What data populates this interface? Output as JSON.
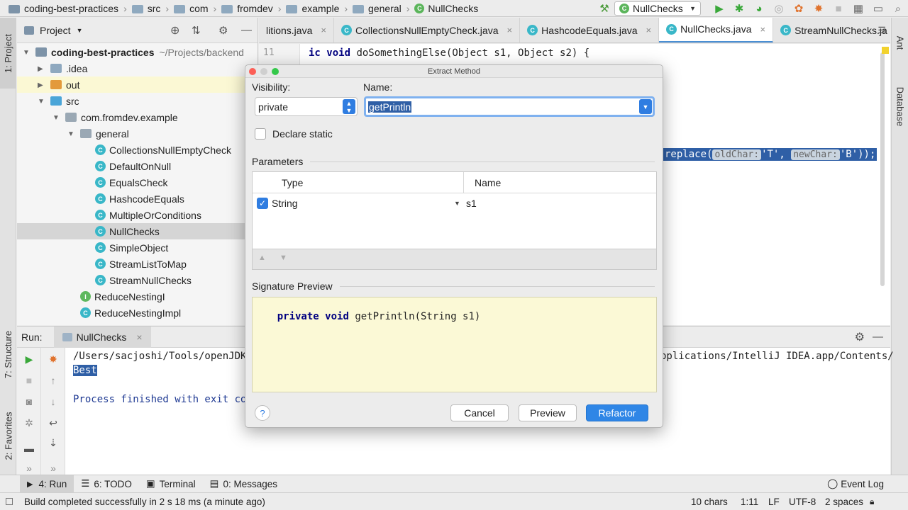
{
  "navbar": {
    "breadcrumbs": [
      "coding-best-practices",
      "src",
      "com",
      "fromdev",
      "example",
      "general",
      "NullChecks"
    ],
    "run_config": "NullChecks"
  },
  "left_strip": {
    "project_tab": "1: Project",
    "structure_tab": "7: Structure",
    "favorites_tab": "2: Favorites"
  },
  "right_strip": {
    "ant_tab": "Ant",
    "database_tab": "Database"
  },
  "project_panel": {
    "title": "Project",
    "tree": [
      {
        "label": "coding-best-practices",
        "suffix": "~/Projects/backend",
        "kind": "project",
        "depth": 0,
        "expanded": true
      },
      {
        "label": ".idea",
        "kind": "folder",
        "depth": 1,
        "expanded": false
      },
      {
        "label": "out",
        "kind": "folder-out",
        "depth": 1,
        "expanded": false
      },
      {
        "label": "src",
        "kind": "folder-src",
        "depth": 1,
        "expanded": true
      },
      {
        "label": "com.fromdev.example",
        "kind": "package",
        "depth": 2,
        "expanded": true
      },
      {
        "label": "general",
        "kind": "package",
        "depth": 3,
        "expanded": true
      },
      {
        "label": "CollectionsNullEmptyCheck",
        "kind": "class",
        "depth": 4
      },
      {
        "label": "DefaultOnNull",
        "kind": "class",
        "depth": 4
      },
      {
        "label": "EqualsCheck",
        "kind": "class",
        "depth": 4
      },
      {
        "label": "HashcodeEquals",
        "kind": "class",
        "depth": 4
      },
      {
        "label": "MultipleOrConditions",
        "kind": "class",
        "depth": 4
      },
      {
        "label": "NullChecks",
        "kind": "class",
        "depth": 4,
        "selected": true
      },
      {
        "label": "SimpleObject",
        "kind": "class",
        "depth": 4
      },
      {
        "label": "StreamListToMap",
        "kind": "class",
        "depth": 4
      },
      {
        "label": "StreamNullChecks",
        "kind": "class",
        "depth": 4
      },
      {
        "label": "ReduceNestingI",
        "kind": "interface",
        "depth": 3
      },
      {
        "label": "ReduceNestingImpl",
        "kind": "class",
        "depth": 3
      }
    ]
  },
  "editor_tabs": [
    {
      "label": "litions.java"
    },
    {
      "label": "CollectionsNullEmptyCheck.java"
    },
    {
      "label": "HashcodeEquals.java"
    },
    {
      "label": "NullChecks.java",
      "active": true
    },
    {
      "label": "StreamNullChecks.ja"
    }
  ],
  "editor": {
    "line_number": "11",
    "line_keyword1": "ic",
    "line_keyword2": "void",
    "line_text": "doSomethingElse(Object s1, Object s2) {",
    "replace_prefix": "replace(",
    "hint1": "oldChar:",
    "arg1": "'T',",
    "hint2": "newChar:",
    "arg2": "'B'));"
  },
  "run_panel": {
    "label": "Run:",
    "tab": "NullChecks",
    "output_line1": "/Users/sacjoshi/Tools/openJDK",
    "output_line1_right": "pplications/IntelliJ IDEA.app/Contents/",
    "output_line2": "Best",
    "output_line3": "Process finished with exit cod"
  },
  "bottom_tabs": [
    {
      "label": "4: Run",
      "active": true
    },
    {
      "label": "6: TODO"
    },
    {
      "label": "Terminal"
    },
    {
      "label": "0: Messages"
    }
  ],
  "event_log": "Event Log",
  "status": {
    "message": "Build completed successfully in 2 s 18 ms (a minute ago)",
    "chars": "10 chars",
    "position": "1:11",
    "line_sep": "LF",
    "encoding": "UTF-8",
    "indent": "2 spaces"
  },
  "dialog": {
    "title": "Extract Method",
    "visibility_label": "Visibility:",
    "visibility_value": "private",
    "name_label": "Name:",
    "name_value": "getPrintln",
    "declare_static": "Declare static",
    "parameters_title": "Parameters",
    "col_type": "Type",
    "col_name": "Name",
    "param_type": "String",
    "param_name": "s1",
    "signature_title": "Signature Preview",
    "sig_kw1": "private",
    "sig_kw2": "void",
    "sig_rest": "getPrintln(String s1)",
    "help": "?",
    "cancel": "Cancel",
    "preview": "Preview",
    "refactor": "Refactor"
  },
  "colors": {
    "accent": "#2f86e6",
    "selection": "#2f5fa6",
    "signature_bg": "#fbf9d6"
  }
}
